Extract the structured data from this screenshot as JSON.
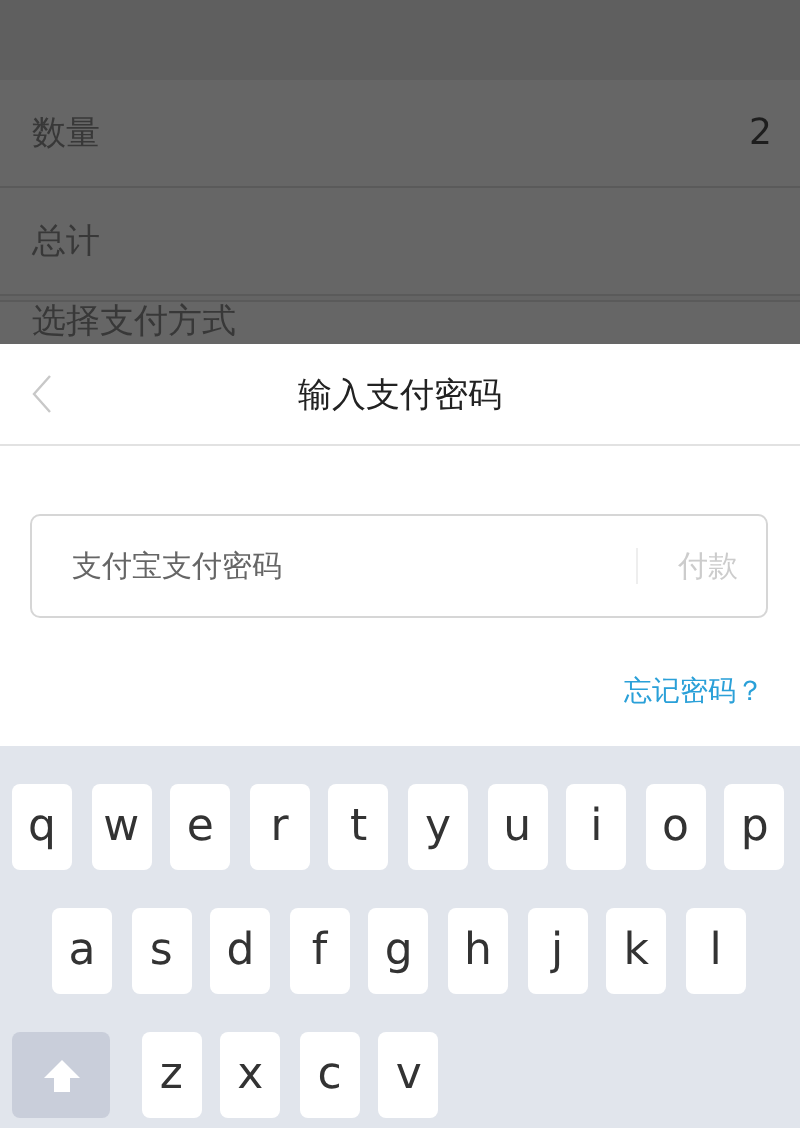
{
  "background_list": {
    "rows": [
      {
        "label": "数量",
        "value": "2"
      },
      {
        "label": "总计"
      },
      {
        "label": "选择支付方式"
      }
    ]
  },
  "password_sheet": {
    "title": "输入支付密码",
    "password_field": {
      "placeholder": "支付宝支付密码"
    },
    "pay_button": {
      "label": "付款",
      "disabled": true
    },
    "forgot_link": "忘记密码？"
  },
  "keyboard": {
    "rows": [
      [
        "q",
        "w",
        "e",
        "r",
        "t",
        "y",
        "u",
        "i",
        "o",
        "p"
      ],
      [
        "a",
        "s",
        "d",
        "f",
        "g",
        "h",
        "j",
        "k",
        "l"
      ],
      [
        "z",
        "x",
        "c",
        "v"
      ]
    ]
  }
}
